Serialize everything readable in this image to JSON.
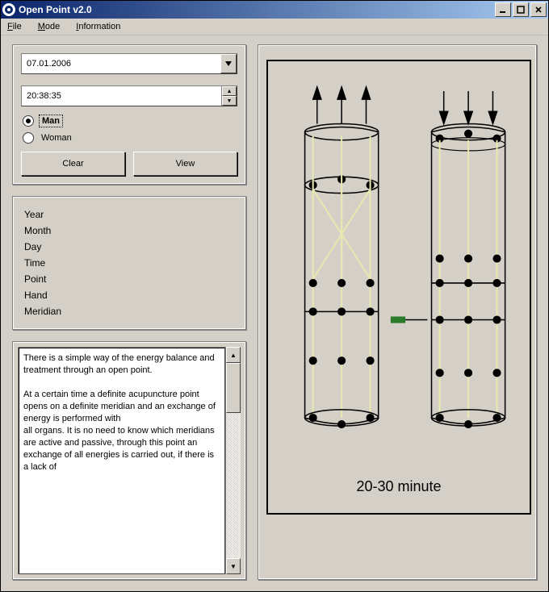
{
  "window": {
    "title": "Open Point v2.0"
  },
  "menu": {
    "file": "File",
    "mode": "Mode",
    "information": "Information"
  },
  "inputs": {
    "date_value": "07.01.2006",
    "time_value": "20:38:35",
    "gender_man": "Man",
    "gender_woman": "Woman",
    "selected_gender": "man"
  },
  "buttons": {
    "clear": "Clear",
    "view": "View"
  },
  "labels": {
    "year": "Year",
    "month": "Month",
    "day": "Day",
    "time": "Time",
    "point": "Point",
    "hand": "Hand",
    "meridian": "Meridian"
  },
  "info_text": "There is a simple way of the energy balance and treatment through an open point.\n\nAt a certain time a definite acupuncture point opens on a definite meridian and an exchange of energy is performed with\nall organs. It is no need to know which meridians are active and passive, through this point an exchange of all energies is carried out, if there is a lack of",
  "diagram": {
    "caption": "20-30 minute"
  }
}
